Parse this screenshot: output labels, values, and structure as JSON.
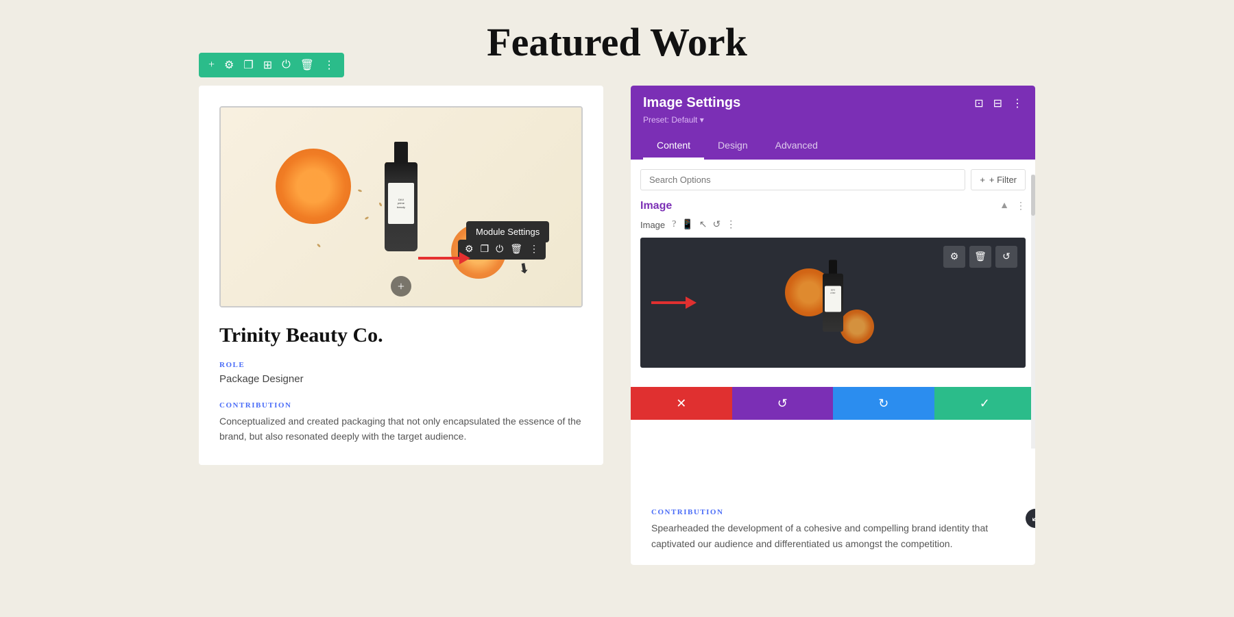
{
  "page": {
    "title": "Featured Work",
    "background": "#f0ede4"
  },
  "module_toolbar": {
    "tools": [
      "+",
      "⚙",
      "❐",
      "⊞",
      "⏻",
      "🗑",
      "⋮"
    ]
  },
  "tooltip": {
    "label": "Module Settings"
  },
  "left_card": {
    "product_title": "Trinity Beauty Co.",
    "role_label": "ROLE",
    "role_value": "Package Designer",
    "contribution_label": "CONTRIBUTION",
    "contribution_text": "Conceptualized and created packaging that not only encapsulated the essence of the brand, but also resonated deeply with the target audience."
  },
  "settings_panel": {
    "title": "Image Settings",
    "preset": "Preset: Default ▾",
    "tabs": [
      "Content",
      "Design",
      "Advanced"
    ],
    "active_tab": "Content",
    "search_placeholder": "Search Options",
    "filter_label": "+ Filter",
    "image_section_title": "Image",
    "image_label": "Image",
    "action_buttons": {
      "cancel": "✕",
      "undo": "↺",
      "redo": "↻",
      "confirm": "✓"
    }
  },
  "right_card": {
    "contribution_label": "CONTRIBUTION",
    "contribution_text": "Spearheaded the development of a cohesive and compelling brand identity that captivated our audience and differentiated us amongst the competition."
  },
  "colors": {
    "teal": "#2bbc8a",
    "purple": "#7b2fb5",
    "blue": "#2b8def",
    "red": "#e03030",
    "accent_blue": "#4a6cf7"
  }
}
